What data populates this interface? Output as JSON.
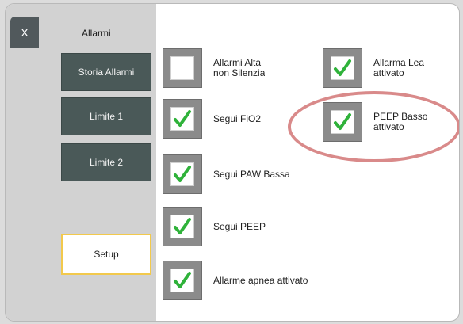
{
  "window": {
    "title": "Allarmi",
    "close_label": "X"
  },
  "nav": [
    {
      "label": "Storia Allarmi"
    },
    {
      "label": "Limite 1"
    },
    {
      "label": "Limite 2"
    }
  ],
  "setup": {
    "label": "Setup"
  },
  "options": [
    {
      "label": "Allarmi Alta\nnon Silenzia",
      "checked": false
    },
    {
      "label": "Segui FiO2",
      "checked": true
    },
    {
      "label": "Segui PAW Bassa",
      "checked": true
    },
    {
      "label": "Segui PEEP",
      "checked": true
    },
    {
      "label": "Allarme apnea attivato",
      "checked": true
    },
    {
      "label": "Allarma Lea\nattivato",
      "checked": true
    },
    {
      "label": "PEEP Basso\nattivato",
      "checked": true
    }
  ],
  "colors": {
    "check": "#2fb23a",
    "highlight": "#d98a8a"
  }
}
